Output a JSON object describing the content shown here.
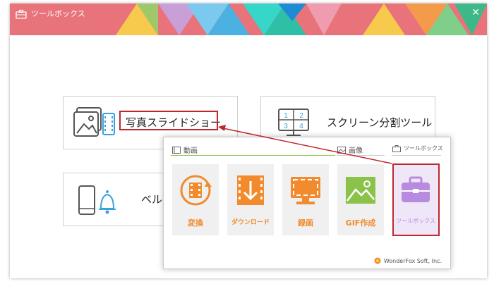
{
  "window": {
    "title": "ツールボックス",
    "close_glyph": "✕"
  },
  "cards": {
    "slideshow": {
      "label": "写真スライドショー",
      "icon": "photo-slideshow-icon"
    },
    "split": {
      "label": "スクリーン分割ツール",
      "icon": "screen-split-icon",
      "cells": [
        "1",
        "2",
        "3",
        "4"
      ]
    },
    "ringtone": {
      "label": "ベル",
      "icon": "phone-bell-icon"
    }
  },
  "popup": {
    "tabs": [
      {
        "label": "動画",
        "icon": "film-icon"
      },
      {
        "label": "画像",
        "icon": "image-icon"
      },
      {
        "label": "ツールボックス",
        "icon": "toolbox-icon"
      }
    ],
    "tiles": [
      {
        "label": "変換",
        "icon": "convert-icon",
        "color": "#f18b2e"
      },
      {
        "label": "ダウンロード",
        "icon": "download-icon",
        "color": "#f18b2e"
      },
      {
        "label": "録画",
        "icon": "record-icon",
        "color": "#f18b2e"
      },
      {
        "label": "GIF作成",
        "icon": "gif-icon",
        "color": "#8bc34a"
      },
      {
        "label": "ツールボックス",
        "icon": "toolbox-icon",
        "color": "#b68be0"
      }
    ],
    "footer": "WonderFox Soft, Inc."
  },
  "colors": {
    "accent_red": "#c0272d",
    "orange": "#f18b2e",
    "purple": "#b68be0"
  }
}
